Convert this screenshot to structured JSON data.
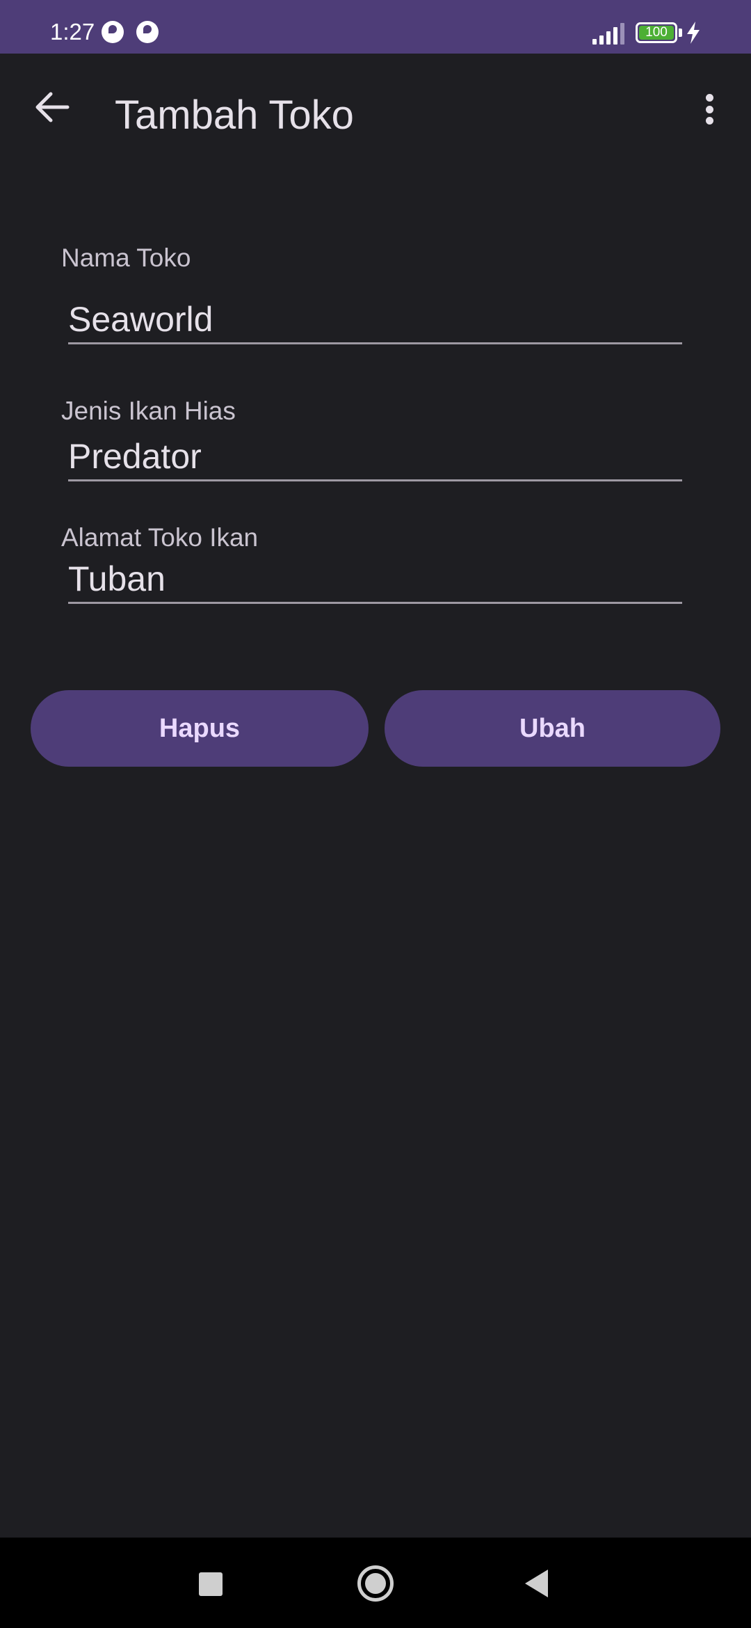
{
  "status_bar": {
    "time": "1:27",
    "battery_level": "100",
    "icons": [
      "app-notification-icon",
      "app-notification-icon",
      "signal-icon",
      "battery-icon",
      "charging-bolt-icon"
    ]
  },
  "app_bar": {
    "title": "Tambah Toko",
    "back_icon": "arrow-back-icon",
    "menu_icon": "more-vert-icon"
  },
  "form": {
    "nama_toko": {
      "label": "Nama Toko",
      "value": "Seaworld"
    },
    "jenis_ikan": {
      "label": "Jenis Ikan Hias",
      "value": "Predator"
    },
    "alamat": {
      "label": "Alamat Toko Ikan",
      "value": "Tuban"
    }
  },
  "actions": {
    "delete_label": "Hapus",
    "update_label": "Ubah"
  },
  "colors": {
    "primary": "#4e3d78",
    "background": "#1e1e22",
    "button_text": "#ead9ff",
    "battery": "#4caf34"
  },
  "nav_bar": {
    "icons": [
      "recents-square-icon",
      "home-circle-icon",
      "back-triangle-icon"
    ]
  }
}
